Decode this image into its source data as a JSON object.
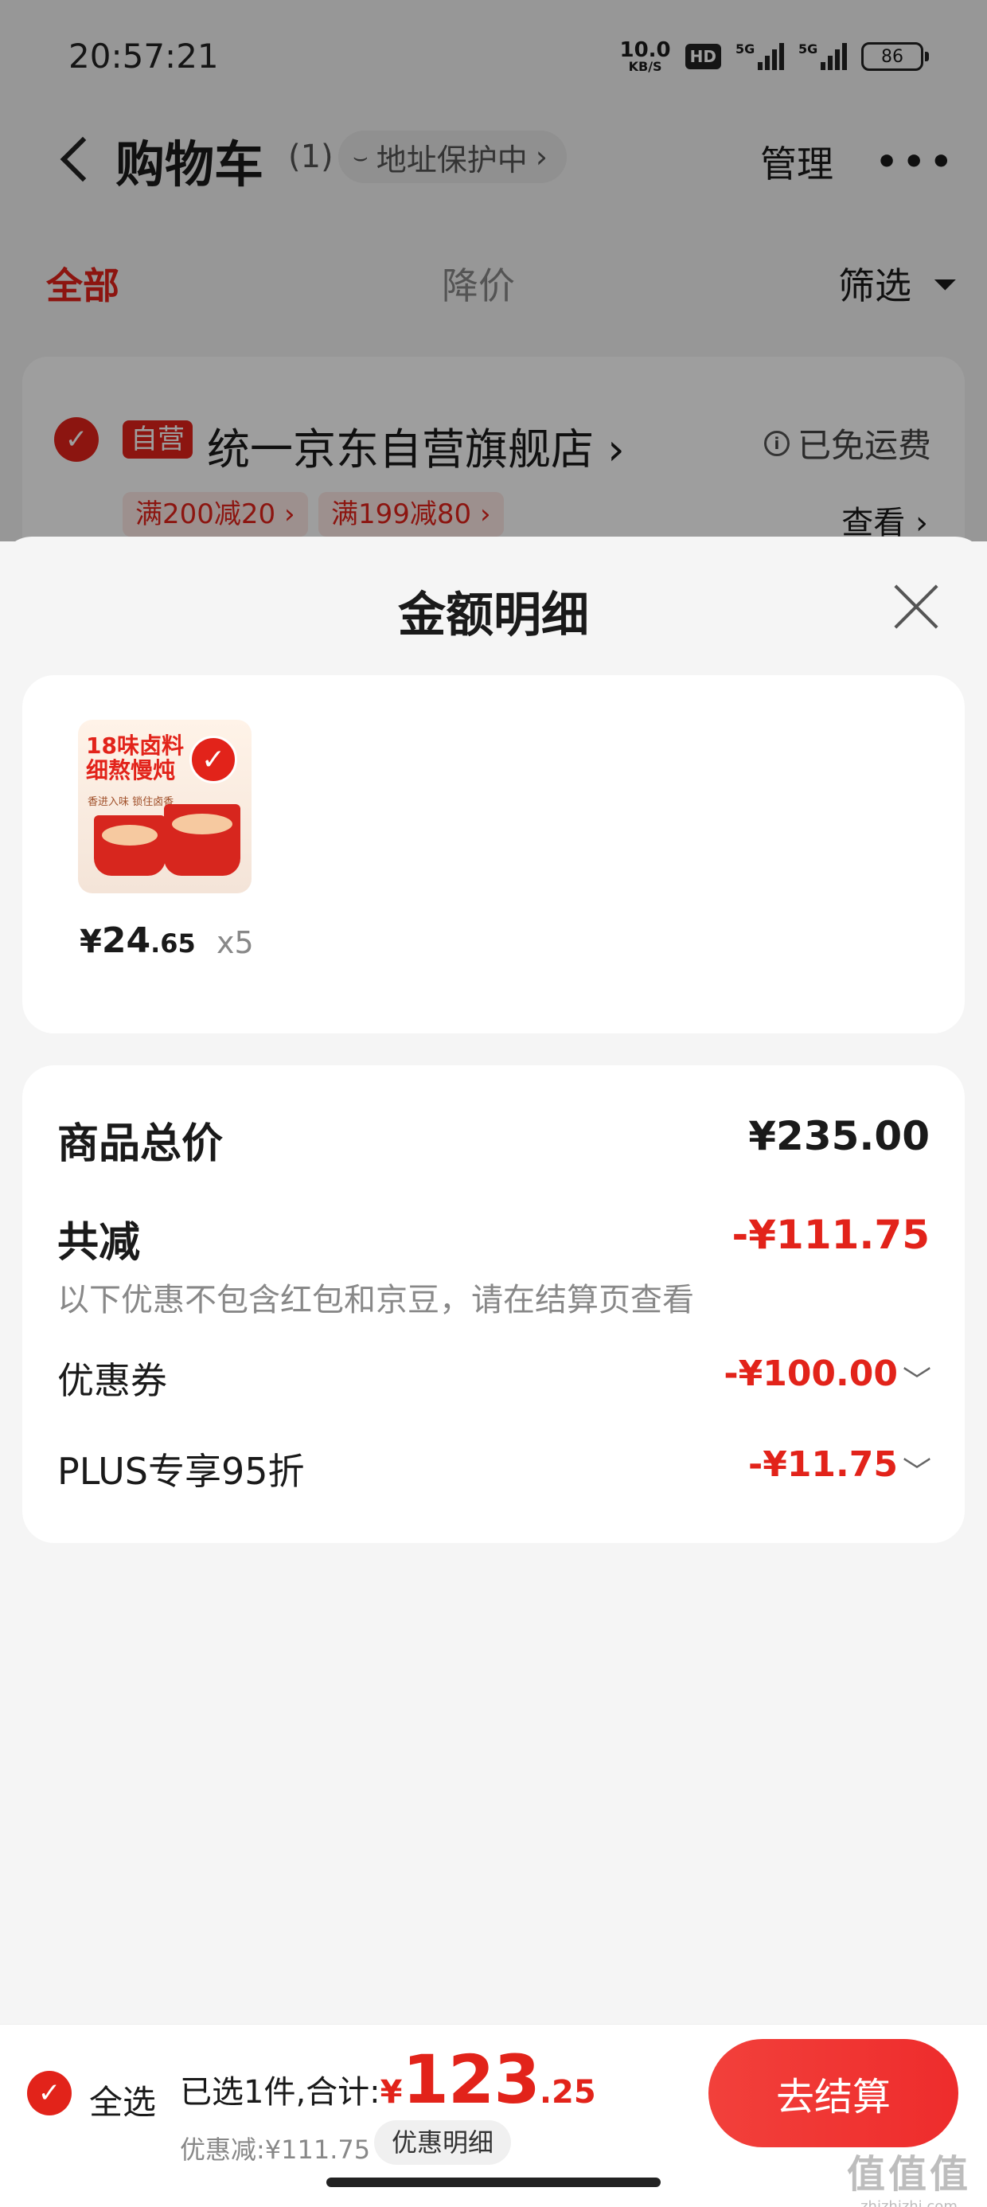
{
  "status_bar": {
    "time": "20:57:21",
    "net_speed_value": "10.0",
    "net_speed_unit": "KB/S",
    "hd_label": "HD",
    "signal_1": "5G",
    "signal_2": "5G",
    "battery": "86"
  },
  "header": {
    "title": "购物车",
    "count": "(1)",
    "address_protect": "地址保护中",
    "manage": "管理"
  },
  "tabs": {
    "all": "全部",
    "price_drop": "降价",
    "filter": "筛选"
  },
  "shop": {
    "badge": "自营",
    "name": "统一京东自营旗舰店",
    "shipping": "已免运费",
    "promos": [
      "满200减20",
      "满199减80"
    ],
    "view": "查看"
  },
  "sheet": {
    "title": "金额明细",
    "product": {
      "image_text_line1": "18味卤料",
      "image_text_line2": "细熬慢炖",
      "image_subtext": "香进入味 锁住卤香",
      "price_symbol": "¥",
      "price_int": "24",
      "price_dec": ".65",
      "quantity": "x5"
    },
    "summary": {
      "total_label": "商品总价",
      "total_value": "¥235.00",
      "reduce_label": "共减",
      "reduce_value": "-¥111.75",
      "note": "以下优惠不包含红包和京豆，请在结算页查看",
      "coupon_label": "优惠券",
      "coupon_value": "-¥100.00",
      "plus_label": "PLUS专享95折",
      "plus_value": "-¥11.75"
    }
  },
  "bottom_bar": {
    "select_all": "全选",
    "selected_text": "已选1件,合计:",
    "sum_symbol": "¥",
    "sum_int": "123",
    "sum_dec": ".25",
    "discount_text": "优惠减:¥111.75",
    "detail_button": "优惠明细",
    "checkout_button": "去结算"
  },
  "watermark": {
    "url": "zhizhizhi.com"
  },
  "colors": {
    "accent": "#e2231a",
    "overlay": "rgba(0,0,0,0.38)"
  }
}
